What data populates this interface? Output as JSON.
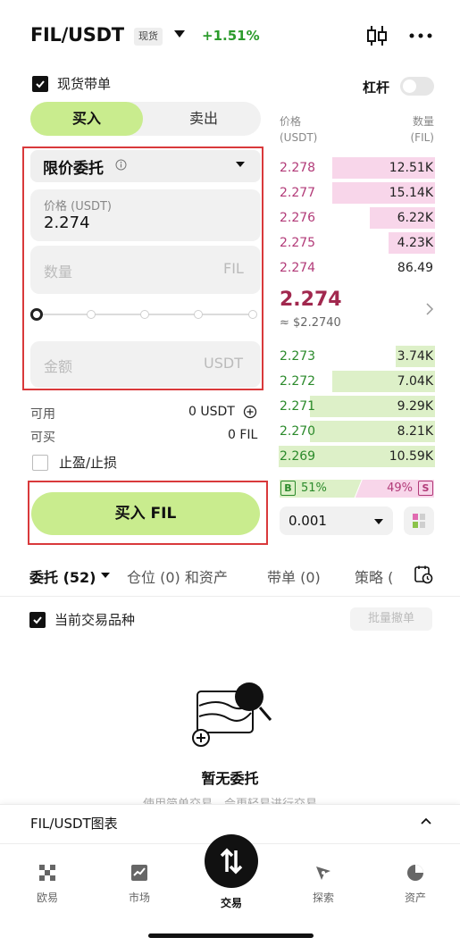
{
  "header": {
    "pair": "FIL/USDT",
    "market_tag": "现货",
    "change": "+1.51%"
  },
  "options": {
    "follow_label": "现货带单",
    "follow_checked": true,
    "leverage_label": "杠杆",
    "leverage_on": false
  },
  "segment": {
    "buy": "买入",
    "sell": "卖出",
    "active": "buy"
  },
  "form": {
    "order_type": "限价委托",
    "price_placeholder": "价格 (USDT)",
    "price_value": "2.274",
    "qty_placeholder": "数量",
    "qty_unit": "FIL",
    "amount_placeholder": "金额",
    "amount_unit": "USDT",
    "slider_percent": 0,
    "available_label": "可用",
    "available_value": "0 USDT",
    "buyable_label": "可买",
    "buyable_value": "0 FIL",
    "tpsl_label": "止盈/止损",
    "submit_label": "买入 FIL"
  },
  "orderbook": {
    "price_header": "价格",
    "price_unit": "(USDT)",
    "qty_header": "数量",
    "qty_unit": "(FIL)",
    "asks": [
      {
        "price": "2.278",
        "qty": "12.51K",
        "depth": 0.66
      },
      {
        "price": "2.277",
        "qty": "15.14K",
        "depth": 0.66
      },
      {
        "price": "2.276",
        "qty": "6.22K",
        "depth": 0.42
      },
      {
        "price": "2.275",
        "qty": "4.23K",
        "depth": 0.3
      },
      {
        "price": "2.274",
        "qty": "86.49",
        "depth": 0.0
      }
    ],
    "mid_price": "2.274",
    "mid_usd": "≈ $2.2740",
    "bids": [
      {
        "price": "2.273",
        "qty": "3.74K",
        "depth": 0.25
      },
      {
        "price": "2.272",
        "qty": "7.04K",
        "depth": 0.66
      },
      {
        "price": "2.271",
        "qty": "9.29K",
        "depth": 0.8
      },
      {
        "price": "2.270",
        "qty": "8.21K",
        "depth": 0.8
      },
      {
        "price": "2.269",
        "qty": "10.59K",
        "depth": 1.0
      }
    ],
    "buy_badge": "B",
    "buy_ratio": "51%",
    "sell_ratio": "49%",
    "sell_badge": "S",
    "precision": "0.001"
  },
  "tabs": {
    "orders": "委托 (52)",
    "positions": "仓位 (0) 和资产",
    "copy": "带单 (0)",
    "strategy": "策略 ("
  },
  "filter": {
    "current_label": "当前交易品种",
    "current_checked": true,
    "cancel_all": "批量撤单"
  },
  "empty": {
    "title": "暂无委托",
    "subtitle": "使用简单交易，会更轻易进行交易"
  },
  "chart_bar": {
    "label": "FIL/USDT图表"
  },
  "nav": [
    {
      "label": "欧易",
      "icon": "okx-logo-icon"
    },
    {
      "label": "市场",
      "icon": "market-chart-icon"
    },
    {
      "label": "交易",
      "icon": "trade-arrows-icon"
    },
    {
      "label": "探索",
      "icon": "explore-compass-icon"
    },
    {
      "label": "资产",
      "icon": "assets-pie-icon"
    }
  ],
  "colors": {
    "buy_green": "#c9ec8e",
    "ask_pink": "#f8d6ea",
    "bid_green": "#ddf0c8",
    "ask_text": "#b23a78",
    "bid_text": "#2b8a2b",
    "highlight_red": "#d9393b"
  }
}
